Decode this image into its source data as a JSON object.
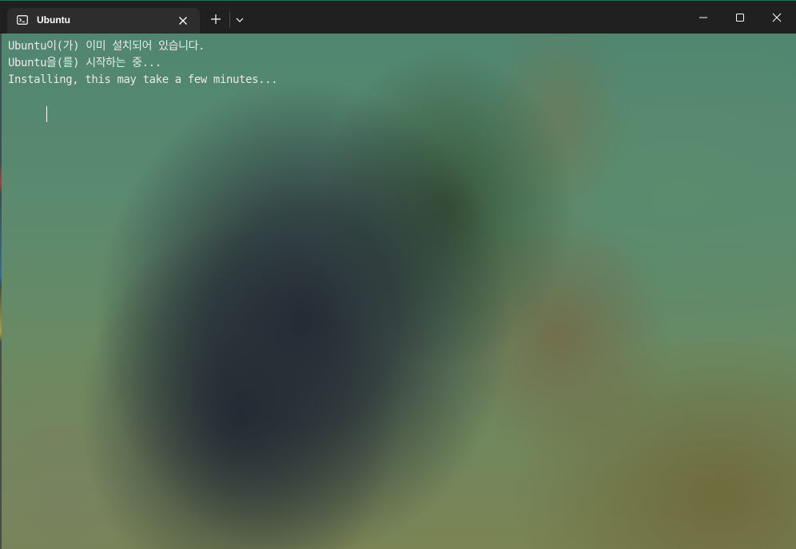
{
  "window": {
    "tab_title": "Ubuntu",
    "tab_icon": "terminal-icon",
    "accent_color": "#2d6a55"
  },
  "titlebar": {
    "new_tab_icon": "plus-icon",
    "dropdown_icon": "chevron-down-icon",
    "minimize_icon": "minimize-icon",
    "maximize_icon": "maximize-icon",
    "close_icon": "close-icon"
  },
  "terminal": {
    "lines": [
      "Ubuntu이(가) 이미 설치되어 있습니다.",
      "Ubuntu을(를) 시작하는 중...",
      "Installing, this may take a few minutes..."
    ],
    "text_color": "#e8e8e8"
  }
}
